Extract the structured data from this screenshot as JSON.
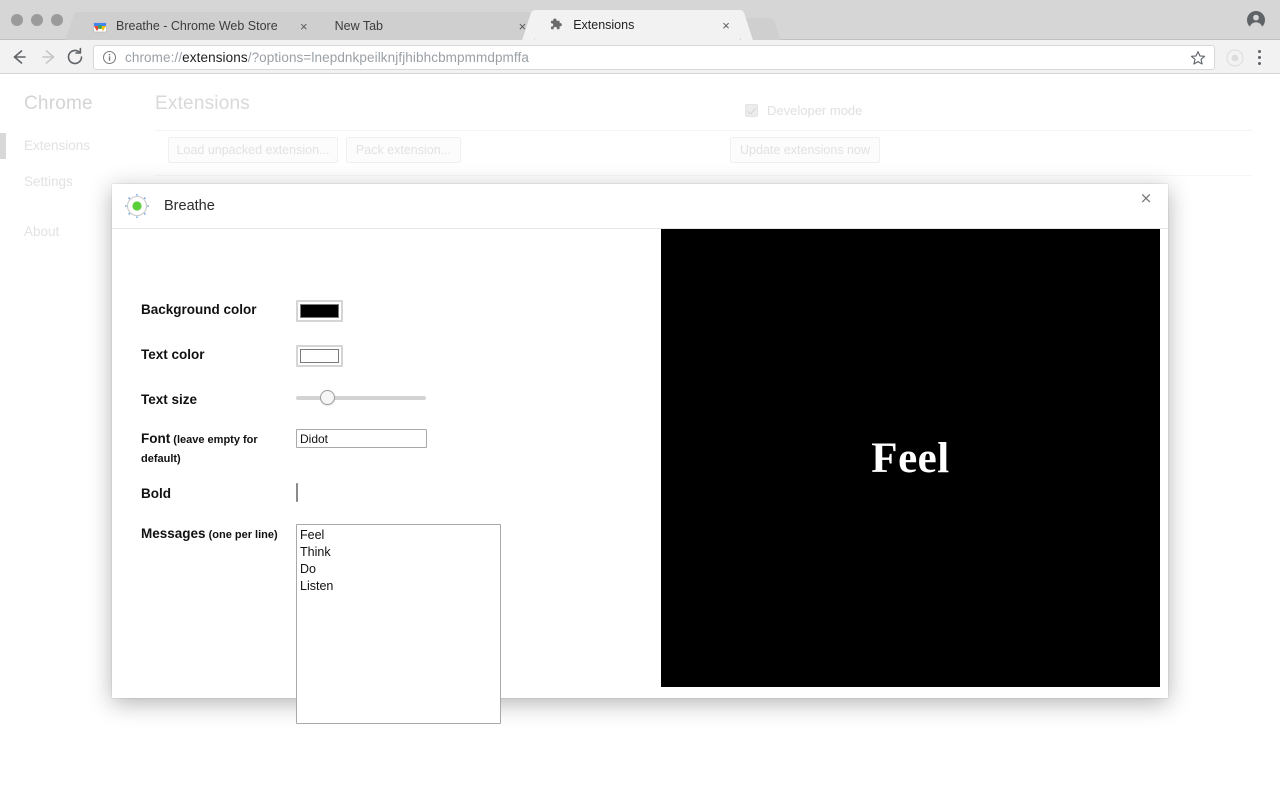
{
  "browser": {
    "window_controls": [
      "close",
      "minimize",
      "maximize"
    ],
    "tabs": [
      {
        "title": "Breathe - Chrome Web Store",
        "favicon": "chrome-web-store-icon",
        "active": false,
        "close_label": "×"
      },
      {
        "title": "New Tab",
        "favicon": "none",
        "active": false,
        "close_label": "×"
      },
      {
        "title": "Extensions",
        "favicon": "puzzle-piece-icon",
        "active": true,
        "close_label": "×"
      }
    ],
    "toolbar": {
      "back_icon": "back-arrow-icon",
      "forward_icon": "forward-arrow-icon",
      "reload_icon": "reload-icon",
      "info_icon": "info-circle-icon",
      "star_icon": "bookmark-star-icon",
      "extension_icon": "breathe-extension-icon",
      "menu_icon": "three-dot-menu-icon",
      "profile_icon": "profile-avatar-icon",
      "url_prefix": "chrome://",
      "url_strong": "extensions",
      "url_suffix": "/?options=lnepdnkpeilknjfjhibhcbmpmmdpmffa"
    }
  },
  "extensions_page": {
    "brand": "Chrome",
    "nav_items": [
      {
        "label": "Extensions",
        "active": true
      },
      {
        "label": "Settings",
        "active": false
      },
      {
        "label": "About",
        "active": false
      }
    ],
    "header_title": "Extensions",
    "developer_mode": {
      "label": "Developer mode",
      "checked": true
    },
    "buttons": {
      "load_unpacked": "Load unpacked extension...",
      "pack_extension": "Pack extension...",
      "update_extensions": "Update extensions now"
    }
  },
  "dialog": {
    "title": "Breathe",
    "icon": "breathe-green-dot-icon",
    "close_label": "×",
    "fields": {
      "background_color": {
        "label": "Background color",
        "value": "#000000"
      },
      "text_color": {
        "label": "Text color",
        "value": "#ffffff"
      },
      "text_size": {
        "label": "Text size",
        "percent": 21
      },
      "font": {
        "label": "Font",
        "sublabel": " (leave empty for default)",
        "value": "Didot",
        "placeholder": ""
      },
      "bold": {
        "label": "Bold",
        "checked": true
      },
      "messages": {
        "label": "Messages",
        "sublabel": " (one per line)",
        "value": "Feel\nThink\nDo\nListen",
        "lines": [
          "Feel",
          "Think",
          "Do",
          "Listen"
        ]
      }
    },
    "preview": {
      "text": "Feel",
      "background": "#000000",
      "color": "#ffffff",
      "font": "Didot",
      "bold": true
    }
  }
}
